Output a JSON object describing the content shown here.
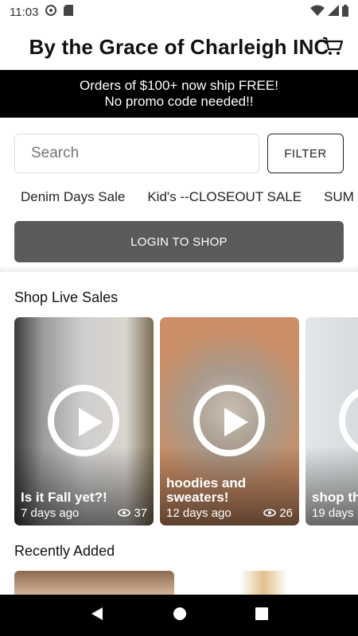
{
  "status_bar": {
    "time": "11:03"
  },
  "header": {
    "title": "By the Grace of Charleigh INC"
  },
  "promo": {
    "line1": "Orders of $100+ now ship FREE!",
    "line2": "No promo code needed!!"
  },
  "search": {
    "placeholder": "Search",
    "filter_label": "FILTER"
  },
  "tags": [
    "Denim Days Sale",
    "Kid's --CLOSEOUT SALE",
    "SUM"
  ],
  "login_label": "LOGIN TO SHOP",
  "live_sales": {
    "heading": "Shop Live Sales",
    "items": [
      {
        "title": "Is it Fall yet?!",
        "age": "7 days ago",
        "views": "37"
      },
      {
        "title": "hoodies and sweaters!",
        "age": "12 days ago",
        "views": "26"
      },
      {
        "title": "shop th",
        "age": "19 days",
        "views": ""
      }
    ]
  },
  "recently_added": {
    "heading": "Recently Added"
  },
  "colors": {
    "promo_bg": "#000000",
    "login_bg": "#5a5a5a",
    "nav_bg": "#000000"
  }
}
